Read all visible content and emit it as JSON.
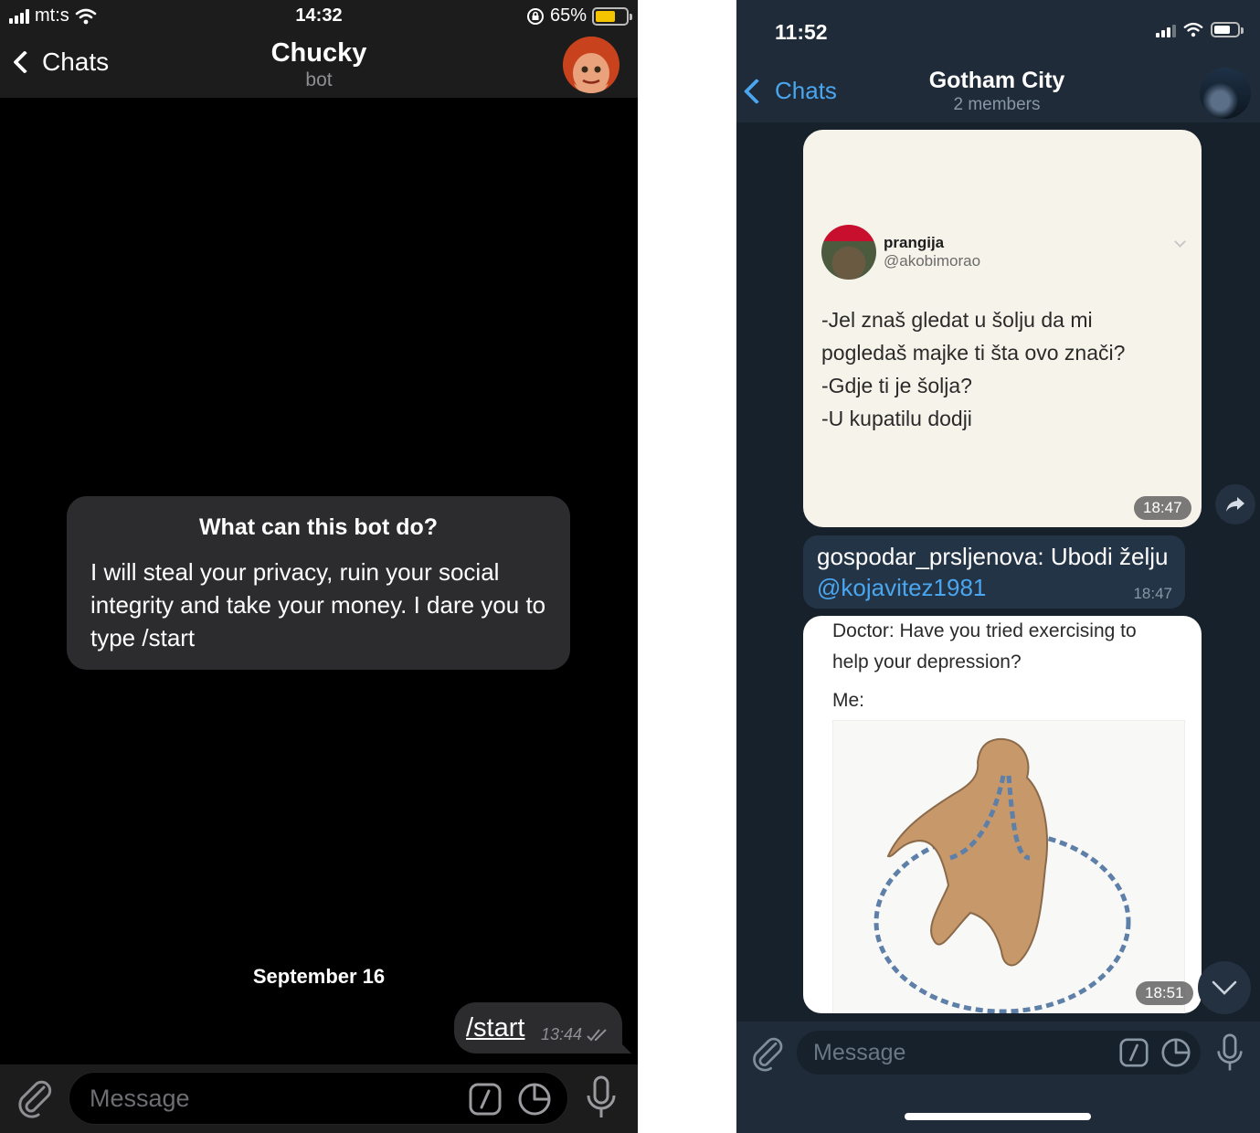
{
  "left_screen": {
    "status": {
      "carrier": "mt:s",
      "time": "14:32",
      "battery_percent": "65%",
      "battery_level": 0.65,
      "battery_color": "#f5c400"
    },
    "header": {
      "back_label": "Chats",
      "title": "Chucky",
      "subtitle": "bot"
    },
    "bot_info": {
      "question": "What can this bot do?",
      "description": "I will steal your privacy, ruin your social integrity and take your money. I dare you to type /start"
    },
    "date_separator": "September 16",
    "outgoing_message": {
      "text": "/start",
      "time": "13:44"
    },
    "composer": {
      "placeholder": "Message"
    },
    "icons": [
      "signal-icon",
      "wifi-icon",
      "orientation-lock-icon",
      "battery-icon",
      "back-chevron-icon",
      "attach-icon",
      "command-icon",
      "sticker-icon",
      "mic-icon",
      "read-check-icon"
    ]
  },
  "right_screen": {
    "status": {
      "time": "11:52",
      "battery_level": 0.7
    },
    "header": {
      "back_label": "Chats",
      "title": "Gotham City",
      "subtitle": "2 members"
    },
    "tweet": {
      "name": "prangija",
      "handle": "@akobimorao",
      "lines": [
        "-Jel znaš gledat u šolju da mi",
        "pogledaš majke ti šta ovo znači?",
        "-Gdje ti je šolja?",
        "-U kupatilu dodji"
      ],
      "time": "18:47"
    },
    "text_message": {
      "text": "gospodar_prsljenova: Ubodi želju",
      "mention": "@kojavitez1981",
      "time": "18:47"
    },
    "meme": {
      "lines": [
        "Doctor: Have you tried exercising to",
        "help your depression?"
      ],
      "me_label": "Me:",
      "time": "18:51"
    },
    "composer": {
      "placeholder": "Message"
    },
    "accent_color": "#4aa6ef",
    "icons": [
      "share-icon",
      "scroll-down-icon",
      "attach-icon",
      "command-icon",
      "sticker-icon",
      "mic-icon"
    ]
  }
}
